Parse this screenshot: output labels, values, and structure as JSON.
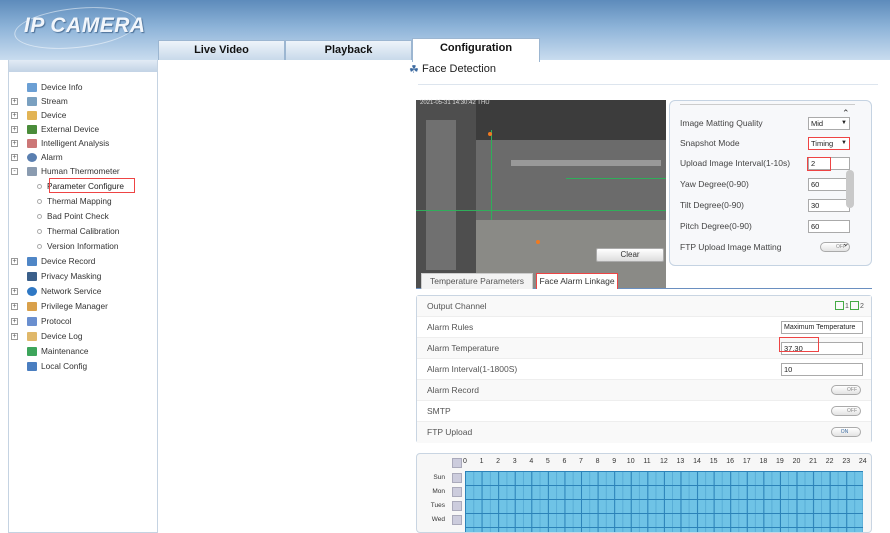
{
  "app": {
    "logo": "IP CAMERA"
  },
  "tabs": [
    {
      "label": "Live Video"
    },
    {
      "label": "Playback"
    },
    {
      "label": "Configuration"
    }
  ],
  "sidebar": {
    "items": [
      {
        "label": "Device Info"
      },
      {
        "label": "Stream"
      },
      {
        "label": "Device"
      },
      {
        "label": "External Device"
      },
      {
        "label": "Intelligent Analysis"
      },
      {
        "label": "Alarm"
      },
      {
        "label": "Human Thermometer"
      },
      {
        "label": "Parameter Configure"
      },
      {
        "label": "Thermal Mapping"
      },
      {
        "label": "Bad Point Check"
      },
      {
        "label": "Thermal Calibration"
      },
      {
        "label": "Version Information"
      },
      {
        "label": "Device Record"
      },
      {
        "label": "Privacy Masking"
      },
      {
        "label": "Network Service"
      },
      {
        "label": "Privilege Manager"
      },
      {
        "label": "Protocol"
      },
      {
        "label": "Device Log"
      },
      {
        "label": "Maintenance"
      },
      {
        "label": "Local Config"
      }
    ]
  },
  "page": {
    "title": "Face Detection"
  },
  "video": {
    "timestamp": "2021-05-31 14:30:42 THU",
    "clear_label": "Clear"
  },
  "params": {
    "matting_quality": {
      "label": "Image Matting Quality",
      "value": "Mid"
    },
    "snapshot_mode": {
      "label": "Snapshot Mode",
      "value": "Timing"
    },
    "upload_interval": {
      "label": "Upload Image Interval(1-10s)",
      "value": "2"
    },
    "yaw": {
      "label": "Yaw Degree(0-90)",
      "value": "60"
    },
    "tilt": {
      "label": "Tilt Degree(0-90)",
      "value": "30"
    },
    "pitch": {
      "label": "Pitch Degree(0-90)",
      "value": "60"
    },
    "ftp_matting": {
      "label": "FTP Upload Image Matting",
      "value": "OFF"
    }
  },
  "subtabs": [
    {
      "label": "Temperature Parameters"
    },
    {
      "label": "Face Alarm Linkage"
    }
  ],
  "alarm": {
    "output_channel": {
      "label": "Output Channel",
      "opt1": "1",
      "opt2": "2"
    },
    "rules": {
      "label": "Alarm Rules",
      "value": "Maximum Temperature"
    },
    "temperature": {
      "label": "Alarm Temperature",
      "value": "37.30"
    },
    "interval": {
      "label": "Alarm Interval(1-1800S)",
      "value": "10"
    },
    "record": {
      "label": "Alarm Record",
      "value": "OFF"
    },
    "smtp": {
      "label": "SMTP",
      "value": "OFF"
    },
    "ftp": {
      "label": "FTP Upload",
      "value": "ON"
    }
  },
  "schedule": {
    "hours": [
      "0",
      "1",
      "2",
      "3",
      "4",
      "5",
      "6",
      "7",
      "8",
      "9",
      "10",
      "11",
      "12",
      "13",
      "14",
      "15",
      "16",
      "17",
      "18",
      "19",
      "20",
      "21",
      "22",
      "23",
      "24"
    ],
    "days": [
      "Sun",
      "Mon",
      "Tues",
      "Wed"
    ]
  }
}
